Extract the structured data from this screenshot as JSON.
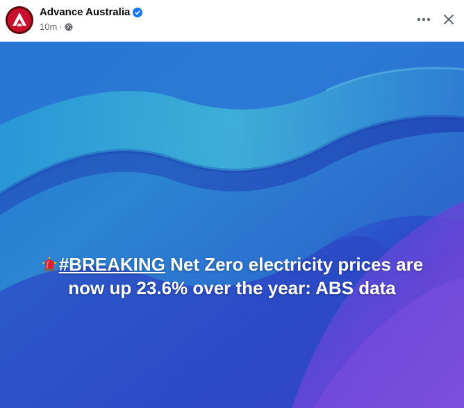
{
  "post": {
    "page_name": "Advance Australia",
    "time": "10m",
    "separator": "·",
    "caption_hashtag": "#BREAKING",
    "caption_line1_rest": " Net Zero electricity prices are",
    "caption_line2": "now up 23.6% over the year: ABS data"
  },
  "icons": {
    "avatar": "advance-australia-logo",
    "verified": "verified-badge-icon",
    "audience": "globe-icon",
    "more": "more-options-icon",
    "close": "close-icon",
    "emoji": "siren-emoji-icon"
  },
  "colors": {
    "verified_blue": "#1877f2",
    "avatar_red": "#c8102e",
    "meta_gray": "#65676b",
    "caption_white": "#ffffff",
    "background_blue": "#2a56c9",
    "background_purple": "#6a3fd4"
  }
}
